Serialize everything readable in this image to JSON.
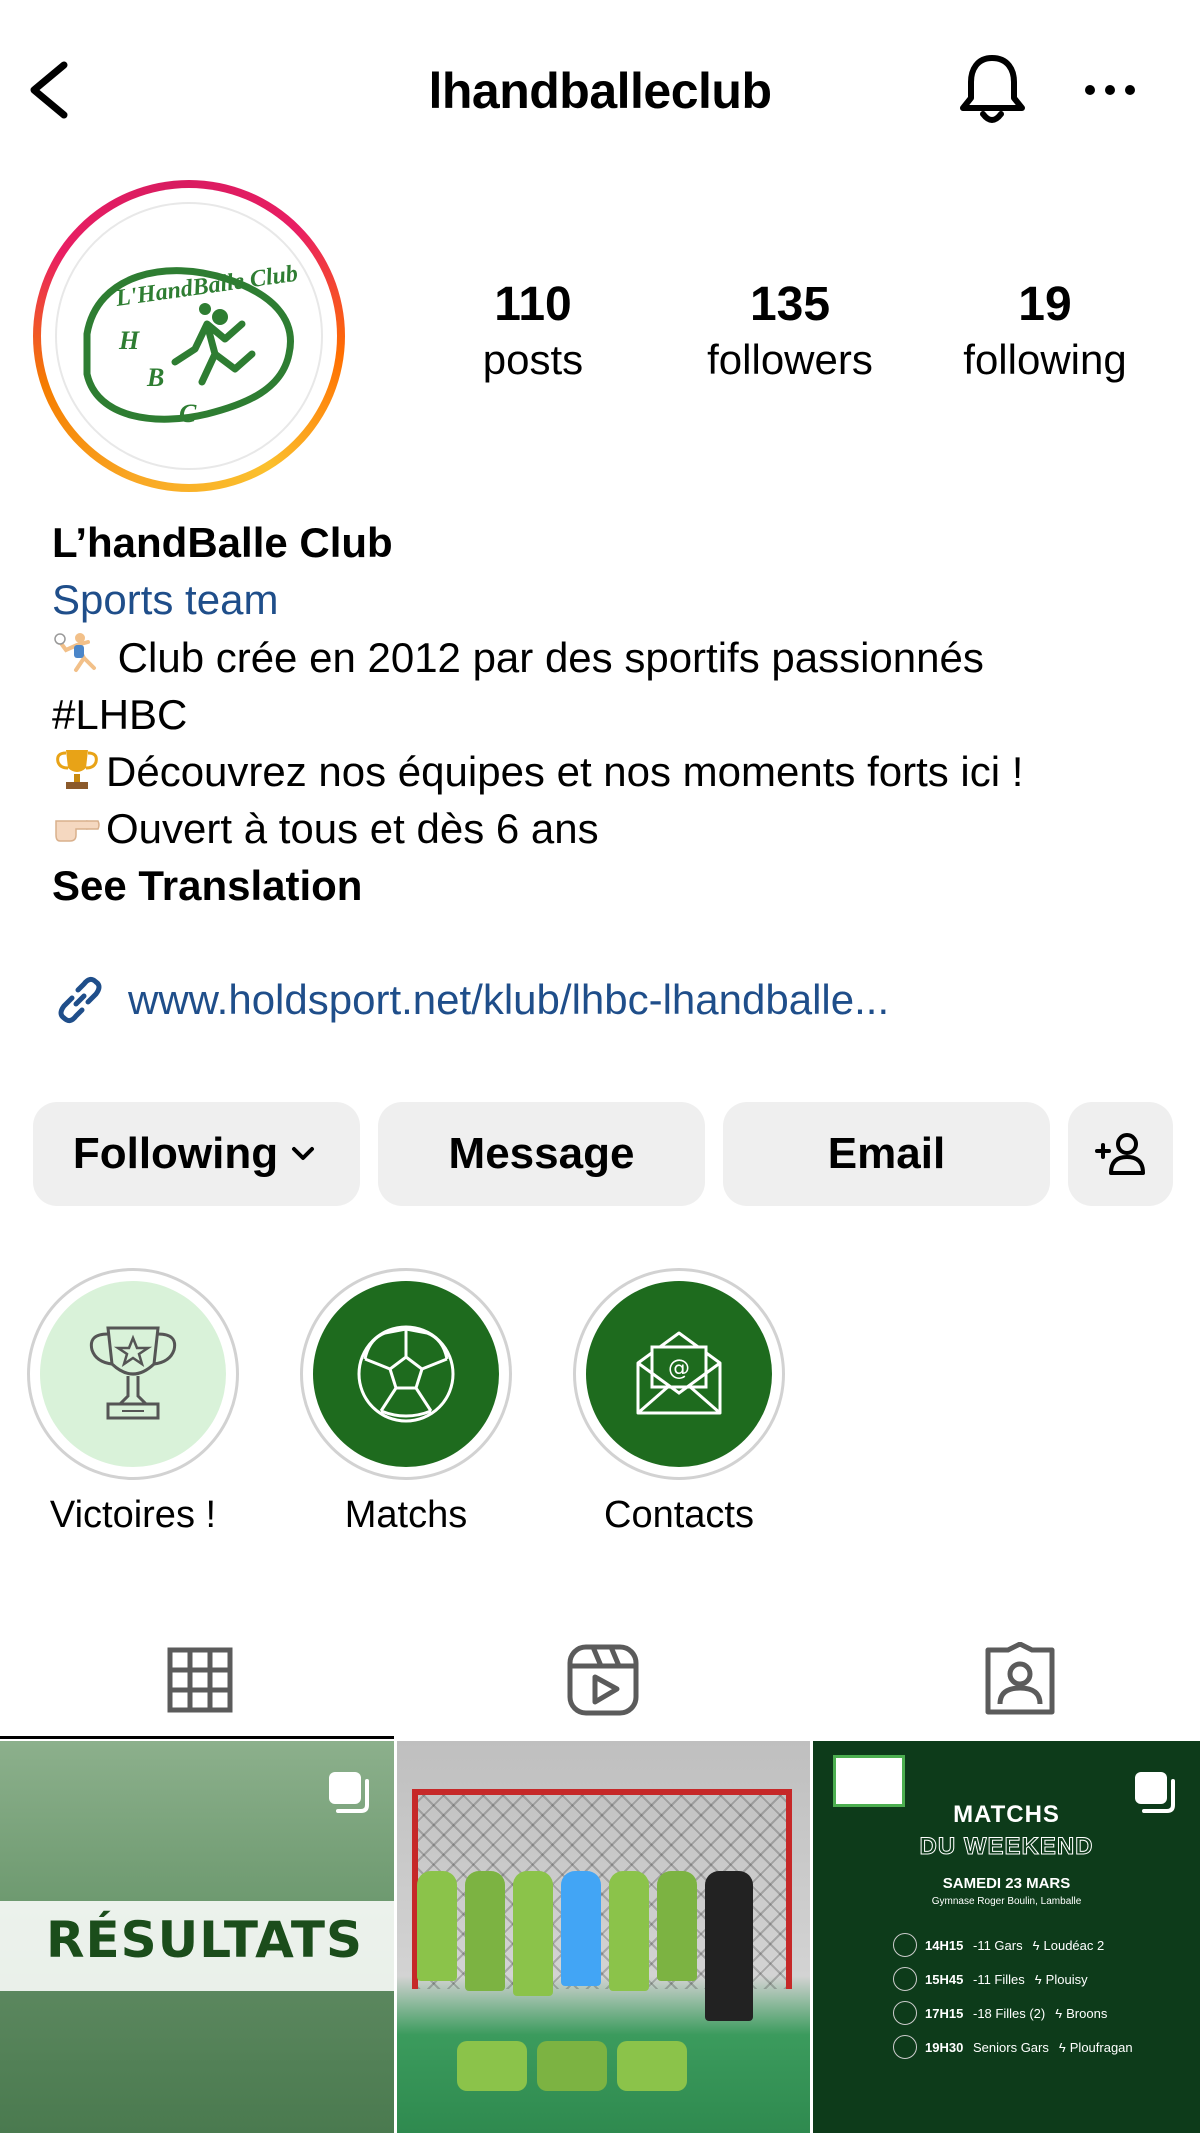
{
  "header": {
    "title": "lhandballeclub",
    "back_icon": "chevron-left-icon",
    "bell_icon": "bell-icon",
    "more_icon": "more-horizontal-icon"
  },
  "profile": {
    "avatar_text": "L'HandBalle Club",
    "avatar_letters": [
      "H",
      "B",
      "C"
    ],
    "stats": [
      {
        "count": "110",
        "label": "posts"
      },
      {
        "count": "135",
        "label": "followers"
      },
      {
        "count": "19",
        "label": "following"
      }
    ],
    "name": "L’handBalle Club",
    "category": "Sports team",
    "bio_lines": [
      {
        "emoji": "handball-player",
        "text": " Club crée en 2012 par des sportifs passionnés"
      },
      {
        "emoji": "",
        "text": "#LHBC"
      },
      {
        "emoji": "trophy",
        "text": "Découvrez nos équipes et nos moments forts ici !"
      },
      {
        "emoji": "pointing-hand",
        "text": "Ouvert à tous et dès 6 ans"
      }
    ],
    "see_translation": "See Translation",
    "link": "www.holdsport.net/klub/lhbc-lhandballe..."
  },
  "actions": {
    "following": "Following",
    "message": "Message",
    "email": "Email"
  },
  "highlights": [
    {
      "label": "Victoires !",
      "icon": "trophy-icon"
    },
    {
      "label": "Matchs",
      "icon": "handball-icon"
    },
    {
      "label": "Contacts",
      "icon": "envelope-icon"
    }
  ],
  "tabs": [
    "grid-icon",
    "reels-icon",
    "tagged-icon"
  ],
  "posts": {
    "post1": {
      "title": "RÉSULTATS"
    },
    "post3": {
      "title_1": "MATCHS",
      "title_2": "DU WEEKEND",
      "date": "SAMEDI 23 MARS",
      "venue": "Gymnase Roger Boulin, Lamballe",
      "matches": [
        {
          "time": "14H15",
          "team": "-11 Gars",
          "opponent": "Loudéac 2"
        },
        {
          "time": "15H45",
          "team": "-11 Filles",
          "opponent": "Plouisy"
        },
        {
          "time": "17H15",
          "team": "-18 Filles (2)",
          "opponent": "Broons"
        },
        {
          "time": "19H30",
          "team": "Seniors Gars",
          "opponent": "Ploufragan"
        }
      ]
    }
  },
  "colors": {
    "link": "#1f4e8a",
    "button_bg": "#efefef",
    "club_green": "#2e7d32",
    "dark_green": "#0d3b1a"
  }
}
